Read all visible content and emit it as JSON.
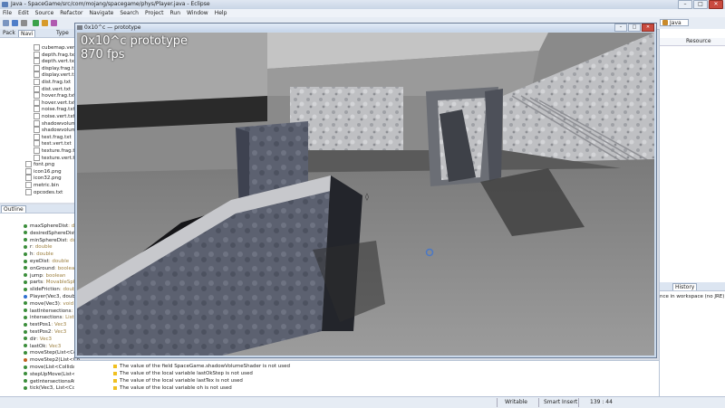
{
  "window": {
    "title": "Java - SpaceGame/src/com/mojang/spacegame/phys/Player.java - Eclipse"
  },
  "menu": [
    "File",
    "Edit",
    "Source",
    "Refactor",
    "Navigate",
    "Search",
    "Project",
    "Run",
    "Window",
    "Help"
  ],
  "toolbar": {
    "perspective": "Java"
  },
  "nav_panel": {
    "tabs": [
      "Pack",
      "Navi",
      "Type"
    ],
    "files": [
      "cubemap.vert.txt",
      "depth.frag.txt",
      "depth.vert.txt",
      "display.frag.txt",
      "display.vert.txt",
      "dist.frag.txt",
      "dist.vert.txt",
      "hover.frag.txt",
      "hover.vert.txt",
      "noise.frag.txt",
      "noise.vert.txt",
      "shadowvolume",
      "shadowvolume",
      "test.frag.txt",
      "test.vert.txt",
      "texture.frag.txt",
      "texture.vert.txt",
      "font.png",
      "icon16.png",
      "icon32.png",
      "metric.bin",
      "opcodes.txt"
    ]
  },
  "outline": {
    "title": "Outline",
    "rows": [
      {
        "name": "maxSphereDist",
        "type": ": double",
        "color": "#3a8d3a"
      },
      {
        "name": "desiredSphereDist",
        "type": "",
        "color": "#3a8d3a"
      },
      {
        "name": "minSphereDist",
        "type": ": double",
        "color": "#3a8d3a"
      },
      {
        "name": "r",
        "type": ": double",
        "color": "#3a8d3a"
      },
      {
        "name": "h",
        "type": ": double",
        "color": "#3a8d3a"
      },
      {
        "name": "eyeDist",
        "type": ": double",
        "color": "#3a8d3a"
      },
      {
        "name": "onGround",
        "type": ": boolean",
        "color": "#3a8d3a"
      },
      {
        "name": "jump",
        "type": ": boolean",
        "color": "#3a8d3a"
      },
      {
        "name": "parts",
        "type": ": MovableSphe",
        "color": "#3a8d3a"
      },
      {
        "name": "slideFriction",
        "type": ": double",
        "color": "#3a8d3a"
      },
      {
        "name": "Player(Vec3, double",
        "type": "",
        "color": "#2f6fd1"
      },
      {
        "name": "move(Vec3)",
        "type": ": void",
        "color": "#3a8d3a"
      },
      {
        "name": "lastIntersections",
        "type": ": Li",
        "color": "#3a8d3a"
      },
      {
        "name": "intersections",
        "type": ": List<",
        "color": "#3a8d3a"
      },
      {
        "name": "testPos1",
        "type": ": Vec3",
        "color": "#3a8d3a"
      },
      {
        "name": "testPos2",
        "type": ": Vec3",
        "color": "#3a8d3a"
      },
      {
        "name": "dir",
        "type": ": Vec3",
        "color": "#3a8d3a"
      },
      {
        "name": "lastOk",
        "type": ": Vec3",
        "color": "#3a8d3a"
      },
      {
        "name": "moveStep(List<Coll",
        "type": "",
        "color": "#3a8d3a"
      },
      {
        "name": "moveStep2(List<Co",
        "type": "",
        "color": "#c06020"
      },
      {
        "name": "move(List<Collidable>, Vec",
        "type": "",
        "color": "#3a8d3a"
      },
      {
        "name": "stepUpMove(List<Collidab",
        "type": "",
        "color": "#3a8d3a"
      },
      {
        "name": "getIntersectionsAt(Vec3, do",
        "type": "",
        "color": "#3a8d3a"
      },
      {
        "name": "tick(Vec3, List<Collidable>)",
        "type": "",
        "color": "#3a8d3a"
      }
    ]
  },
  "right_panel": {
    "column_header": "Resource",
    "tabs": [
      "History"
    ],
    "message": "nce in workspace (no JRE)"
  },
  "problems": [
    "The value of the field SpaceGame.shadowVolumeShader is not used",
    "The value of the local variable lastOkStep is not used",
    "The value of the local variable lastTex is not used",
    "The value of the local variable oh is not used"
  ],
  "status_bar": {
    "mode": "Writable",
    "insert": "Smart Insert",
    "position": "139 : 44"
  },
  "game": {
    "title": "0x10^c — prototype",
    "hud_line1": "0x10^c prototype",
    "hud_line2": "870 fps"
  }
}
